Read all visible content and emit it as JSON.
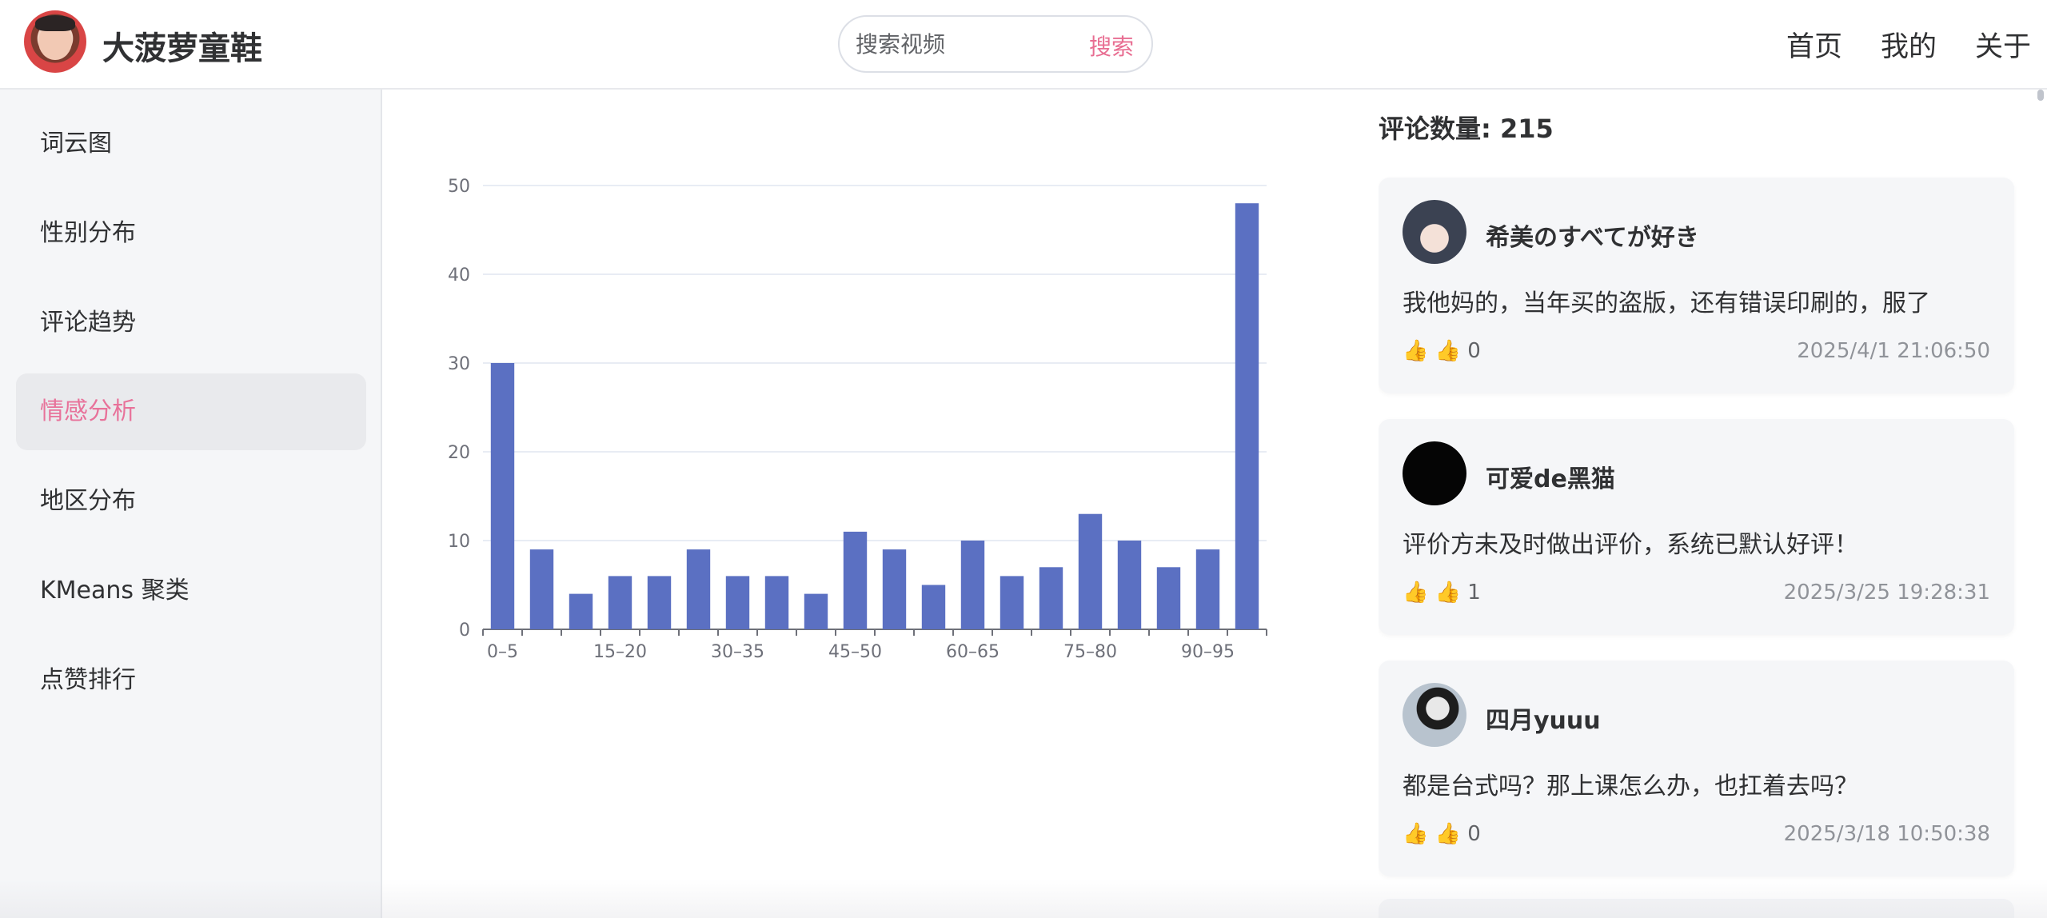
{
  "header": {
    "site_title": "大菠萝童鞋",
    "search_placeholder": "搜索视频",
    "search_button": "搜索",
    "nav": [
      "首页",
      "我的",
      "关于"
    ]
  },
  "sidebar": {
    "items": [
      {
        "label": "词云图",
        "active": false
      },
      {
        "label": "性别分布",
        "active": false
      },
      {
        "label": "评论趋势",
        "active": false
      },
      {
        "label": "情感分析",
        "active": true
      },
      {
        "label": "地区分布",
        "active": false
      },
      {
        "label": "KMeans 聚类",
        "active": false
      },
      {
        "label": "点赞排行",
        "active": false
      }
    ]
  },
  "chart_data": {
    "type": "bar",
    "categories": [
      "0-5",
      "5-10",
      "10-15",
      "15-20",
      "20-25",
      "25-30",
      "30-35",
      "35-40",
      "40-45",
      "45-50",
      "50-55",
      "55-60",
      "60-65",
      "65-70",
      "70-75",
      "75-80",
      "80-85",
      "85-90",
      "90-95",
      "95-100"
    ],
    "tick_labels": [
      "0–5",
      "15–20",
      "30–35",
      "45–50",
      "60–65",
      "75–80",
      "90–95"
    ],
    "values": [
      30,
      9,
      4,
      6,
      6,
      9,
      6,
      6,
      4,
      11,
      9,
      5,
      10,
      6,
      7,
      13,
      10,
      7,
      9,
      48
    ],
    "ylim": [
      0,
      50
    ],
    "yticks": [
      0,
      10,
      20,
      30,
      40,
      50
    ],
    "grid": true,
    "bar_color": "#5b70c2",
    "title": "",
    "xlabel": "",
    "ylabel": ""
  },
  "comments": {
    "count_label": "评论数量: 215",
    "items": [
      {
        "username": "希美のすべてが好き",
        "text": "我他妈的，当年买的盗版，还有错误印刷的，服了",
        "likes": "👍 0",
        "time": "2025/4/1 21:06:50"
      },
      {
        "username": "可爱de黑猫",
        "text": "评价方未及时做出评价，系统已默认好评！",
        "likes": "👍 1",
        "time": "2025/3/25 19:28:31"
      },
      {
        "username": "四月yuuu",
        "text": "都是台式吗？那上课怎么办，也扛着去吗？",
        "likes": "👍 0",
        "time": "2025/3/18 10:50:38"
      }
    ]
  },
  "colors": {
    "accent": "#e8729a",
    "bar": "#5b70c2"
  }
}
